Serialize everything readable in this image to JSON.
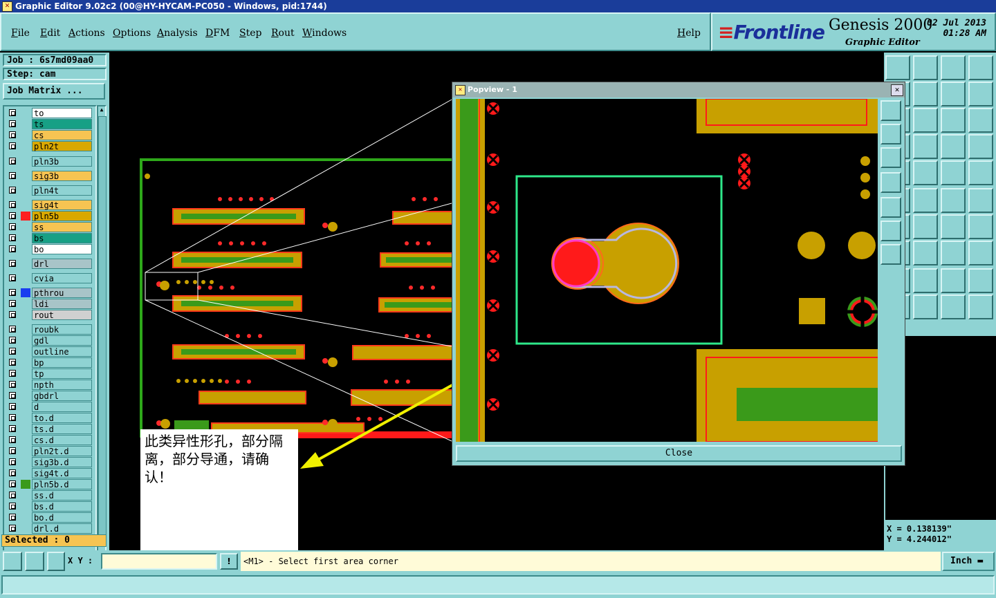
{
  "window": {
    "title": "Graphic Editor 9.02c2 (00@HY-HYCAM-PC050 - Windows, pid:1744)"
  },
  "menu": [
    "File",
    "Edit",
    "Actions",
    "Options",
    "Analysis",
    "DFM",
    "Step",
    "Rout",
    "Windows"
  ],
  "help": "Help",
  "brand": {
    "logo_mark": "≡",
    "logo": "Frontline",
    "product": "Genesis 2000",
    "subtitle": "Graphic Editor",
    "date": "02 Jul 2013",
    "time": "01:28 AM"
  },
  "job": {
    "job": "Job : 6s7md09aa0",
    "step": "Step: cam",
    "matrix_button": "Job Matrix ..."
  },
  "layers": [
    {
      "name": "to",
      "color": "#ffffff",
      "swatch": ""
    },
    {
      "name": "ts",
      "color": "#17a085",
      "swatch": ""
    },
    {
      "name": "cs",
      "color": "#f6c452",
      "swatch": ""
    },
    {
      "name": "pln2t",
      "color": "#d9a800",
      "swatch": ""
    },
    {
      "name": "pln3b",
      "color": "#8fd3d3",
      "swatch": ""
    },
    {
      "name": "sig3b",
      "color": "#f6c452",
      "swatch": ""
    },
    {
      "name": "pln4t",
      "color": "#8fd3d3",
      "swatch": ""
    },
    {
      "name": "sig4t",
      "color": "#f6c452",
      "swatch": ""
    },
    {
      "name": "pln5b",
      "color": "#d9a800",
      "swatch": "#ff2020"
    },
    {
      "name": "ss",
      "color": "#f6c452",
      "swatch": ""
    },
    {
      "name": "bs",
      "color": "#17a085",
      "swatch": ""
    },
    {
      "name": "bo",
      "color": "#ffffff",
      "swatch": ""
    },
    {
      "name": "drl",
      "color": "#a8c4c8",
      "swatch": ""
    },
    {
      "name": "cvia",
      "color": "#8fd3d3",
      "swatch": ""
    },
    {
      "name": "pthrou",
      "color": "#a8c4c8",
      "swatch": "#1a3df0"
    },
    {
      "name": "ldi",
      "color": "#a8c4c8",
      "swatch": ""
    },
    {
      "name": "rout",
      "color": "#d0d0d0",
      "swatch": ""
    },
    {
      "name": "roubk",
      "color": "#8fd3d3",
      "swatch": ""
    },
    {
      "name": "gdl",
      "color": "#8fd3d3",
      "swatch": ""
    },
    {
      "name": "outline",
      "color": "#8fd3d3",
      "swatch": ""
    },
    {
      "name": "bp",
      "color": "#8fd3d3",
      "swatch": ""
    },
    {
      "name": "tp",
      "color": "#8fd3d3",
      "swatch": ""
    },
    {
      "name": "npth",
      "color": "#8fd3d3",
      "swatch": ""
    },
    {
      "name": "gbdrl",
      "color": "#8fd3d3",
      "swatch": ""
    },
    {
      "name": "d",
      "color": "#8fd3d3",
      "swatch": ""
    },
    {
      "name": "to.d",
      "color": "#8fd3d3",
      "swatch": ""
    },
    {
      "name": "ts.d",
      "color": "#8fd3d3",
      "swatch": ""
    },
    {
      "name": "cs.d",
      "color": "#8fd3d3",
      "swatch": ""
    },
    {
      "name": "pln2t.d",
      "color": "#8fd3d3",
      "swatch": ""
    },
    {
      "name": "sig3b.d",
      "color": "#8fd3d3",
      "swatch": ""
    },
    {
      "name": "sig4t.d",
      "color": "#8fd3d3",
      "swatch": ""
    },
    {
      "name": "pln5b.d",
      "color": "#8fd3d3",
      "swatch": "#3a9a1a"
    },
    {
      "name": "ss.d",
      "color": "#8fd3d3",
      "swatch": ""
    },
    {
      "name": "bs.d",
      "color": "#8fd3d3",
      "swatch": ""
    },
    {
      "name": "bo.d",
      "color": "#8fd3d3",
      "swatch": ""
    },
    {
      "name": "drl.d",
      "color": "#8fd3d3",
      "swatch": ""
    }
  ],
  "selected": "Selected : 0",
  "popview": {
    "title": "Popview - 1",
    "close": "Close"
  },
  "note": "此类异性形孔，部分隔离，部分导通，请确认！",
  "coords": {
    "x": "X  = 0.138139\"",
    "y": "Y  = 4.244012\""
  },
  "xy": {
    "label": "X Y :",
    "value": ""
  },
  "prompt": "<M1> - Select first area corner",
  "units": "Inch",
  "colors": {
    "panel": "#8fd3d3",
    "copper": "#c8a000",
    "mask_green": "#3a9a1a",
    "drill_red": "#ff1a1a",
    "outline_green": "#2ee88a"
  }
}
